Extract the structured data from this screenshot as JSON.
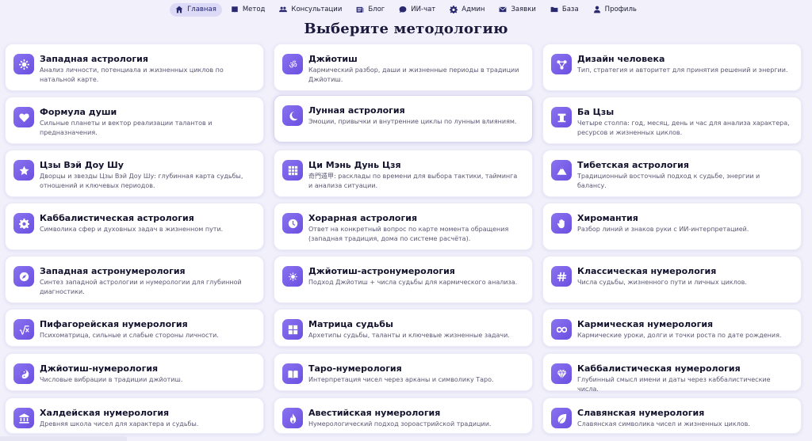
{
  "nav": [
    {
      "label": "Главная",
      "icon": "home-icon",
      "active": true
    },
    {
      "label": "Метод",
      "icon": "book-icon"
    },
    {
      "label": "Консультации",
      "icon": "users-icon"
    },
    {
      "label": "Блог",
      "icon": "newspaper-icon"
    },
    {
      "label": "ИИ-чат",
      "icon": "chat-icon"
    },
    {
      "label": "Админ",
      "icon": "gear-icon"
    },
    {
      "label": "Заявки",
      "icon": "mail-icon"
    },
    {
      "label": "База",
      "icon": "folder-icon"
    },
    {
      "label": "Профиль",
      "icon": "user-icon"
    }
  ],
  "page_title": "Выберите методологию",
  "accent": "#6a4fe0",
  "cards": [
    {
      "title": "Западная астрология",
      "desc": "Анализ личности, потенциала и жизненных циклов по натальной карте.",
      "icon": "sun-gear-icon"
    },
    {
      "title": "Джйотиш",
      "desc": "Кармический разбор, даши и жизненные периоды в традиции Джйотиш.",
      "icon": "om-icon"
    },
    {
      "title": "Дизайн человека",
      "desc": "Тип, стратегия и авторитет для принятия решений и энергии.",
      "icon": "nodes-icon"
    },
    {
      "title": "Формула души",
      "desc": "Сильные планеты и вектор реализации талантов и предназначения.",
      "icon": "heart-icon"
    },
    {
      "title": "Лунная астрология",
      "desc": "Эмоции, привычки и внутренние циклы по лунным влияниям.",
      "icon": "moon-icon"
    },
    {
      "title": "Ба Цзы",
      "desc": "Четыре столпа: год, месяц, день и час для анализа характера, ресурсов и жизненных циклов.",
      "icon": "pillars-icon"
    },
    {
      "title": "Цзы Вэй Доу Шу",
      "desc": "Дворцы и звезды Цзы Вэй Доу Шу: глубинная карта судьбы, отношений и ключевых периодов.",
      "icon": "star-icon"
    },
    {
      "title": "Ци Мэнь Дунь Цзя",
      "desc": "奇門遁甲: расклады по времени для выбора тактики, тайминга и анализа ситуации.",
      "icon": "grid-icon"
    },
    {
      "title": "Тибетская астрология",
      "desc": "Традиционный восточный подход к судьбе, энергии и балансу.",
      "icon": "mountain-icon"
    },
    {
      "title": "Каббалистическая астрология",
      "desc": "Символика сфер и духовных задач в жизненном пути.",
      "icon": "cog-icon"
    },
    {
      "title": "Хорарная астрология",
      "desc": "Ответ на конкретный вопрос по карте момента обращения (западная традиция, дома по системе расчёта).",
      "icon": "clock-icon"
    },
    {
      "title": "Хиромантия",
      "desc": "Разбор линий и знаков руки с ИИ-интерпретацией.",
      "icon": "hand-icon"
    },
    {
      "title": "Западная астронумерология",
      "desc": "Синтез западной астрологии и нумерологии для глубинной диагностики.",
      "icon": "compass-icon"
    },
    {
      "title": "Джйотиш-астронумерология",
      "desc": "Подход Джйотиш + числа судьбы для кармического анализа.",
      "icon": "sunburst-icon"
    },
    {
      "title": "Классическая нумерология",
      "desc": "Числа судьбы, жизненного пути и личных циклов.",
      "icon": "hash-icon"
    },
    {
      "title": "Пифагорейская нумерология",
      "desc": "Психоматрица, сильные и слабые стороны личности.",
      "icon": "sqrt-icon"
    },
    {
      "title": "Матрица судьбы",
      "desc": "Архетипы судьбы, таланты и ключевые жизненные задачи.",
      "icon": "matrix-icon"
    },
    {
      "title": "Кармическая нумерология",
      "desc": "Кармические уроки, долги и точки роста по дате рождения.",
      "icon": "infinity-icon"
    },
    {
      "title": "Джйотиш-нумерология",
      "desc": "Числовые вибрации в традиции джйотиш.",
      "icon": "yin-yang-icon"
    },
    {
      "title": "Таро-нумерология",
      "desc": "Интерпретация чисел через арканы и символику Таро.",
      "icon": "open-book-icon"
    },
    {
      "title": "Каббалистическая нумерология",
      "desc": "Глубинный смысл имени и даты через каббалистические числа.",
      "icon": "gem-icon"
    },
    {
      "title": "Халдейская нумерология",
      "desc": "Древняя школа чисел для характера и судьбы.",
      "icon": "temple-icon"
    },
    {
      "title": "Авестийская нумерология",
      "desc": "Нумерологический подход зороастрийской традиции.",
      "icon": "flame-icon"
    },
    {
      "title": "Славянская нумерология",
      "desc": "Славянская символика чисел и жизненных циклов.",
      "icon": "leaf-icon"
    }
  ]
}
